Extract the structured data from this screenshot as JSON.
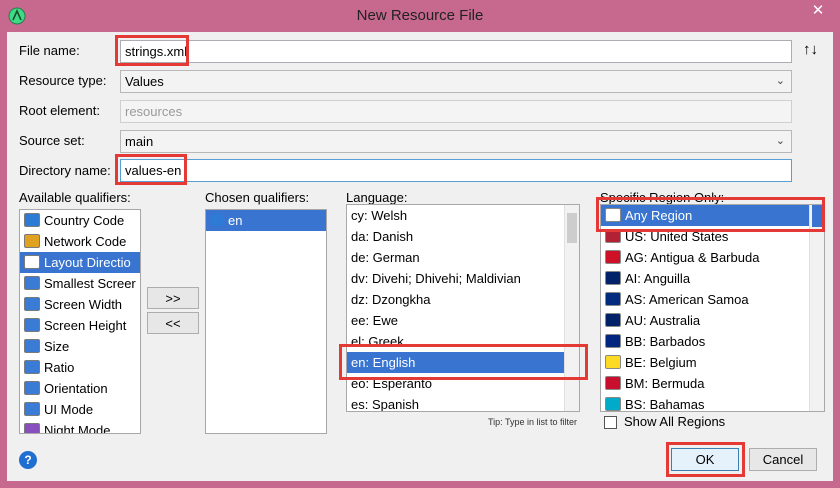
{
  "window": {
    "title": "New Resource File"
  },
  "form": {
    "file_name_label": "File name:",
    "file_name_value": "strings.xml",
    "resource_type_label": "Resource type:",
    "resource_type_value": "Values",
    "root_element_label": "Root element:",
    "root_element_placeholder": "resources",
    "source_set_label": "Source set:",
    "source_set_value": "main",
    "directory_name_label": "Directory name:",
    "directory_name_value": "values-en",
    "sort_glyph": "↑↓"
  },
  "available_qualifiers": {
    "label": "Available qualifiers:",
    "items": [
      {
        "label": "Country Code",
        "icon": "globe-icon",
        "color": "#2e7bd6"
      },
      {
        "label": "Network Code",
        "icon": "network-icon",
        "color": "#e0a020"
      },
      {
        "label": "Layout Directio",
        "icon": "layout-direction-icon",
        "color": "#ffffff"
      },
      {
        "label": "Smallest Screer",
        "icon": "smallest-screen-icon",
        "color": "#3a7bd5"
      },
      {
        "label": "Screen Width",
        "icon": "screen-width-icon",
        "color": "#3a7bd5"
      },
      {
        "label": "Screen Height",
        "icon": "screen-height-icon",
        "color": "#3a7bd5"
      },
      {
        "label": "Size",
        "icon": "size-icon",
        "color": "#3a7bd5"
      },
      {
        "label": "Ratio",
        "icon": "ratio-icon",
        "color": "#3a7bd5"
      },
      {
        "label": "Orientation",
        "icon": "orientation-icon",
        "color": "#3a7bd5"
      },
      {
        "label": "UI Mode",
        "icon": "ui-mode-icon",
        "color": "#3a7bd5"
      },
      {
        "label": "Night Mode",
        "icon": "night-mode-icon",
        "color": "#8a4fbf"
      }
    ],
    "selected_index": 2
  },
  "buttons": {
    "add": ">>",
    "remove": "<<",
    "ok": "OK",
    "cancel": "Cancel",
    "help": "?"
  },
  "chosen_qualifiers": {
    "label": "Chosen qualifiers:",
    "items": [
      {
        "label": "en",
        "icon": "globe-icon"
      }
    ]
  },
  "language": {
    "label": "Language:",
    "items": [
      "cy: Welsh",
      "da: Danish",
      "de: German",
      "dv: Divehi; Dhivehi; Maldivian",
      "dz: Dzongkha",
      "ee: Ewe",
      "el: Greek",
      "en: English",
      "eo: Esperanto",
      "es: Spanish"
    ],
    "selected_index": 7,
    "hint": "Tip: Type in list to filter"
  },
  "region": {
    "label": "Specific Region Only:",
    "items": [
      {
        "label": "Any Region",
        "flag": "blank-flag-icon"
      },
      {
        "label": "US: United States",
        "flag": "us-flag-icon"
      },
      {
        "label": "AG: Antigua & Barbuda",
        "flag": "ag-flag-icon"
      },
      {
        "label": "AI: Anguilla",
        "flag": "ai-flag-icon"
      },
      {
        "label": "AS: American Samoa",
        "flag": "as-flag-icon"
      },
      {
        "label": "AU: Australia",
        "flag": "au-flag-icon"
      },
      {
        "label": "BB: Barbados",
        "flag": "bb-flag-icon"
      },
      {
        "label": "BE: Belgium",
        "flag": "be-flag-icon"
      },
      {
        "label": "BM: Bermuda",
        "flag": "bm-flag-icon"
      },
      {
        "label": "BS: Bahamas",
        "flag": "bs-flag-icon"
      }
    ],
    "selected_index": 0,
    "show_all_label": "Show All Regions"
  },
  "colors": {
    "selection": "#3874d0",
    "highlight": "#e53935",
    "frame": "#c7688f"
  }
}
